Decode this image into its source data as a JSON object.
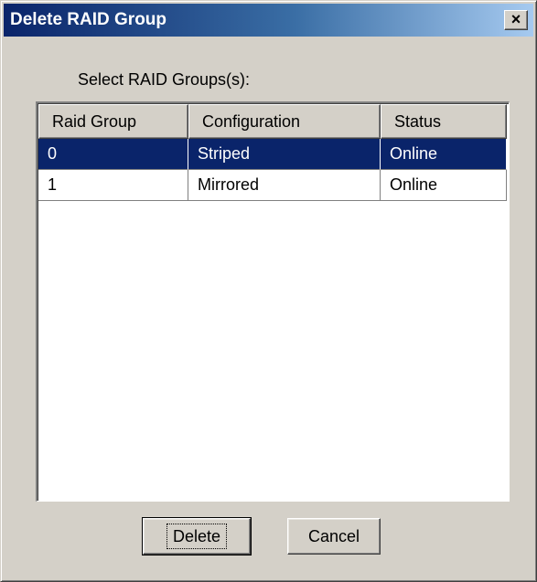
{
  "window": {
    "title": "Delete RAID Group",
    "close_glyph": "×"
  },
  "prompt": "Select RAID Groups(s):",
  "table": {
    "columns": [
      "Raid Group",
      "Configuration",
      "Status"
    ],
    "rows": [
      {
        "group": "0",
        "configuration": "Striped",
        "status": "Online",
        "selected": true
      },
      {
        "group": "1",
        "configuration": "Mirrored",
        "status": "Online",
        "selected": false
      }
    ]
  },
  "buttons": {
    "delete_label": "Delete",
    "cancel_label": "Cancel"
  },
  "colors": {
    "titlebar_start": "#0a246a",
    "titlebar_end": "#a6caf0",
    "selection": "#0a246a",
    "face": "#d4d0c8"
  }
}
